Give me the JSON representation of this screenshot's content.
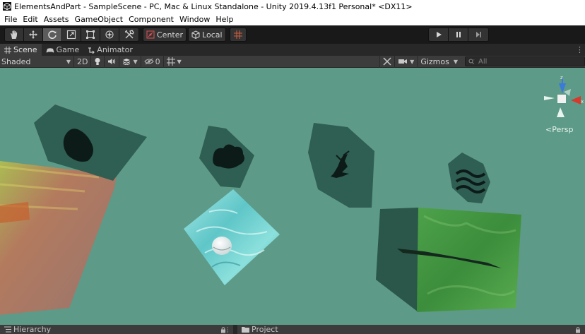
{
  "window": {
    "title": "ElementsAndPart - SampleScene - PC, Mac & Linux Standalone - Unity 2019.4.13f1 Personal* <DX11>"
  },
  "menu": {
    "items": [
      "File",
      "Edit",
      "Assets",
      "GameObject",
      "Component",
      "Window",
      "Help"
    ]
  },
  "toolbar": {
    "pivot_label": "Center",
    "space_label": "Local",
    "active_tool": "rotate"
  },
  "tabs": {
    "scene": "Scene",
    "game": "Game",
    "animator": "Animator",
    "active": "Scene"
  },
  "scene_toolbar": {
    "shading_mode": "Shaded",
    "mode_2d": "2D",
    "hidden_count": "0",
    "gizmos_label": "Gizmos",
    "search_placeholder": "All"
  },
  "scene": {
    "projection_label": "Persp",
    "background_color": "#5d9a87"
  },
  "bottom_tabs": {
    "hierarchy": "Hierarchy",
    "project": "Project"
  }
}
